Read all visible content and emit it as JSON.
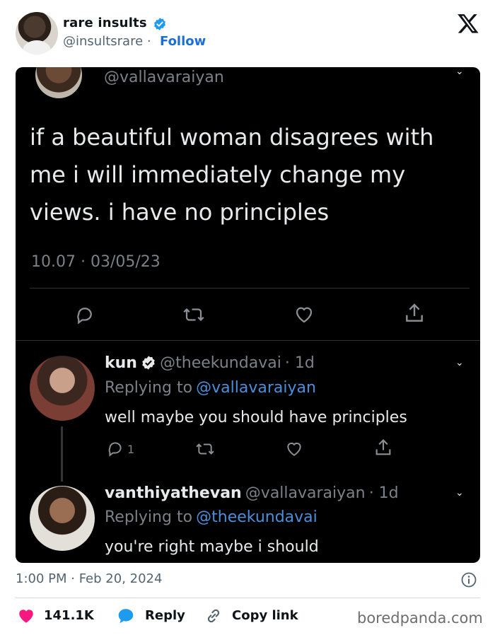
{
  "author": {
    "name": "rare insults",
    "handle": "@insultsrare",
    "separator": "·",
    "follow_label": "Follow"
  },
  "embedded": {
    "original": {
      "handle": "@vallavaraiyan",
      "text": "if a beautiful woman disagrees with me i will immediately change my views. i have no principles",
      "time": "10.07 · 03/05/23"
    },
    "reply1": {
      "name": "kun",
      "handle": "@theekundavai",
      "age": "· 1d",
      "replying_prefix": "Replying to",
      "replying_to": "@vallavaraiyan",
      "text": "well maybe you should have principles",
      "reply_count": "1"
    },
    "reply2": {
      "name": "vanthiyathevan",
      "handle": "@vallavaraiyan",
      "age": "· 1d",
      "replying_prefix": "Replying to",
      "replying_to": "@theekundavai",
      "text": "you're right maybe i should"
    }
  },
  "footer": {
    "timestamp": "1:00 PM · Feb 20, 2024",
    "likes": "141.1K",
    "reply_label": "Reply",
    "copy_label": "Copy link",
    "watermark": "boredpanda.com"
  },
  "colors": {
    "follow": "#1d6fd6",
    "verified": "#1d9bf0",
    "like": "#f91880",
    "reply_icon": "#1d9bf0",
    "embedded_bg": "#000000"
  },
  "icons": [
    "verified-badge-icon",
    "x-logo-icon",
    "reply-icon",
    "retweet-icon",
    "like-icon",
    "share-icon",
    "info-icon",
    "heart-icon",
    "chat-bubble-icon",
    "link-icon"
  ]
}
